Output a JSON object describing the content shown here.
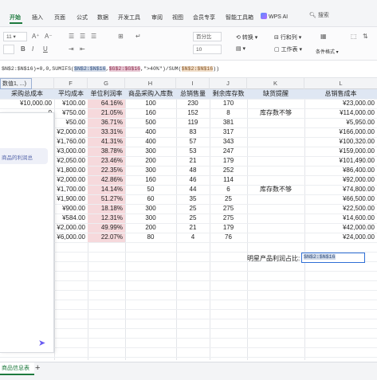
{
  "ribbon": {
    "tabs": [
      "开始",
      "插入",
      "页面",
      "公式",
      "数据",
      "开发工具",
      "审阅",
      "视图",
      "会员专享",
      "智能工具箱"
    ],
    "active_tab": "开始",
    "wps_ai": "WPS AI",
    "search": "搜索"
  },
  "toolbar": {
    "font_size": "11",
    "font_size_alt": "10",
    "number_format": "百分比",
    "convert_label": "转换",
    "rows_cols_label": "行和列",
    "worksheet_label": "工作表",
    "cond_format_label": "条件格式"
  },
  "formula_bar": {
    "prefix": "$N$2:$N$16)=0,0,SUMIFS(",
    "ref1": "$N$2:$N$16",
    "sep1": ",",
    "ref2": "$G$2:$G$16",
    "crit": ",\">40%\")/SUM(",
    "ref3": "$N$2:$N$16",
    "suffix": "))"
  },
  "namebox_tip": "数值1, ...)",
  "columns": [
    {
      "letter": "",
      "header": "采购总成本"
    },
    {
      "letter": "F",
      "header": "平均成本"
    },
    {
      "letter": "G",
      "header": "单位利润率"
    },
    {
      "letter": "H",
      "header": "商品采购入库数"
    },
    {
      "letter": "I",
      "header": "总销售量"
    },
    {
      "letter": "J",
      "header": "剩余库存数"
    },
    {
      "letter": "K",
      "header": "缺货提醒"
    },
    {
      "letter": "L",
      "header": "总销售成本"
    }
  ],
  "rows": [
    {
      "e": "¥10,000.00",
      "f": "¥100.00",
      "g": "64.16%",
      "h": "100",
      "i": "230",
      "j": "170",
      "k": "",
      "l": "¥23,000.00"
    },
    {
      "e": "0",
      "f": "¥750.00",
      "g": "21.05%",
      "h": "160",
      "i": "152",
      "j": "8",
      "k": "库存数不够",
      "l": "¥114,000.00"
    },
    {
      "e": "0",
      "f": "¥50.00",
      "g": "36.71%",
      "h": "500",
      "i": "119",
      "j": "381",
      "k": "",
      "l": "¥5,950.00"
    },
    {
      "e": "0",
      "f": "¥2,000.00",
      "g": "33.31%",
      "h": "400",
      "i": "83",
      "j": "317",
      "k": "",
      "l": "¥166,000.00"
    },
    {
      "e": "0",
      "f": "¥1,760.00",
      "g": "41.31%",
      "h": "400",
      "i": "57",
      "j": "343",
      "k": "",
      "l": "¥100,320.00"
    },
    {
      "e": "0",
      "f": "¥3,000.00",
      "g": "38.78%",
      "h": "300",
      "i": "53",
      "j": "247",
      "k": "",
      "l": "¥159,000.00"
    },
    {
      "e": "0",
      "f": "¥2,050.00",
      "g": "23.46%",
      "h": "200",
      "i": "21",
      "j": "179",
      "k": "",
      "l": "¥101,490.00"
    },
    {
      "e": "0",
      "f": "¥1,800.00",
      "g": "22.35%",
      "h": "300",
      "i": "48",
      "j": "252",
      "k": "",
      "l": "¥86,400.00"
    },
    {
      "e": "0",
      "f": "¥2,000.00",
      "g": "42.86%",
      "h": "160",
      "i": "46",
      "j": "114",
      "k": "",
      "l": "¥92,000.00"
    },
    {
      "e": "0",
      "f": "¥1,700.00",
      "g": "14.14%",
      "h": "50",
      "i": "44",
      "j": "6",
      "k": "库存数不够",
      "l": "¥74,800.00"
    },
    {
      "e": "0",
      "f": "¥1,900.00",
      "g": "51.27%",
      "h": "60",
      "i": "35",
      "j": "25",
      "k": "",
      "l": "¥66,500.00"
    },
    {
      "e": "0",
      "f": "¥900.00",
      "g": "18.18%",
      "h": "300",
      "i": "25",
      "j": "275",
      "k": "",
      "l": "¥22,500.00"
    },
    {
      "e": "0",
      "f": "¥584.00",
      "g": "12.31%",
      "h": "300",
      "i": "25",
      "j": "275",
      "k": "",
      "l": "¥14,600.00"
    },
    {
      "e": "0",
      "f": "¥2,000.00",
      "g": "49.99%",
      "h": "200",
      "i": "21",
      "j": "179",
      "k": "",
      "l": "¥42,000.00"
    },
    {
      "e": "0",
      "f": "¥6,000.00",
      "g": "22.07%",
      "h": "80",
      "i": "4",
      "j": "76",
      "k": "",
      "l": "¥24,000.00"
    }
  ],
  "note": {
    "label": "明星产品利润占比:",
    "value": "$N$2:$N$16"
  },
  "side_panel": {
    "message": "商品的利润总"
  },
  "sheet_bar": {
    "tab": "商品信息表",
    "add": "+"
  },
  "colors": {
    "accent": "#1e7a3e",
    "header_band": "#dfe7f3",
    "profit_column": "#f6d9dc"
  }
}
